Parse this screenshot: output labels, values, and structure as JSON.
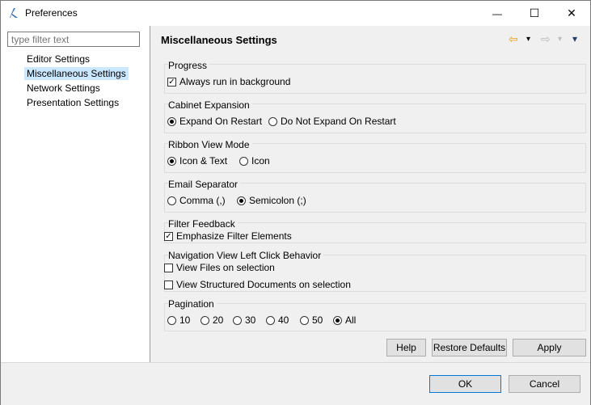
{
  "window": {
    "title": "Preferences"
  },
  "filter": {
    "placeholder": "type filter text"
  },
  "tree": {
    "items": [
      {
        "label": "Editor Settings"
      },
      {
        "label": "Miscellaneous Settings",
        "selected": true
      },
      {
        "label": "Network Settings"
      },
      {
        "label": "Presentation Settings"
      }
    ]
  },
  "page": {
    "title": "Miscellaneous Settings"
  },
  "groups": {
    "progress": {
      "label": "Progress",
      "option": "Always run in background",
      "checked": true
    },
    "cabinet": {
      "label": "Cabinet Expansion",
      "opt1": "Expand On Restart",
      "opt2": "Do Not Expand On Restart",
      "selected": 1
    },
    "ribbon": {
      "label": "Ribbon View Mode",
      "opt1": "Icon & Text",
      "opt2": "Icon",
      "selected": 1
    },
    "email": {
      "label": "Email Separator",
      "opt1": "Comma (,)",
      "opt2": "Semicolon (;)",
      "selected": 2
    },
    "filterfb": {
      "label": "Filter Feedback",
      "option": "Emphasize Filter Elements",
      "checked": true
    },
    "navview": {
      "label": "Navigation View Left Click Behavior",
      "opt1": "View Files on selection",
      "opt2": "View Structured Documents on selection"
    },
    "pagination": {
      "label": "Pagination",
      "options": [
        "10",
        "20",
        "30",
        "40",
        "50",
        "All"
      ],
      "selected": "All"
    }
  },
  "buttons": {
    "help": "Help",
    "restore": "Restore Defaults",
    "apply": "Apply",
    "ok": "OK",
    "cancel": "Cancel"
  },
  "icons": {
    "close": "✕",
    "maximize": "☐",
    "minimize": "—",
    "back": "⇦",
    "forward": "⇨",
    "dropdown": "▾",
    "check": "✓"
  },
  "colors": {
    "selection": "#cce8ff",
    "accent": "#0078d7"
  }
}
